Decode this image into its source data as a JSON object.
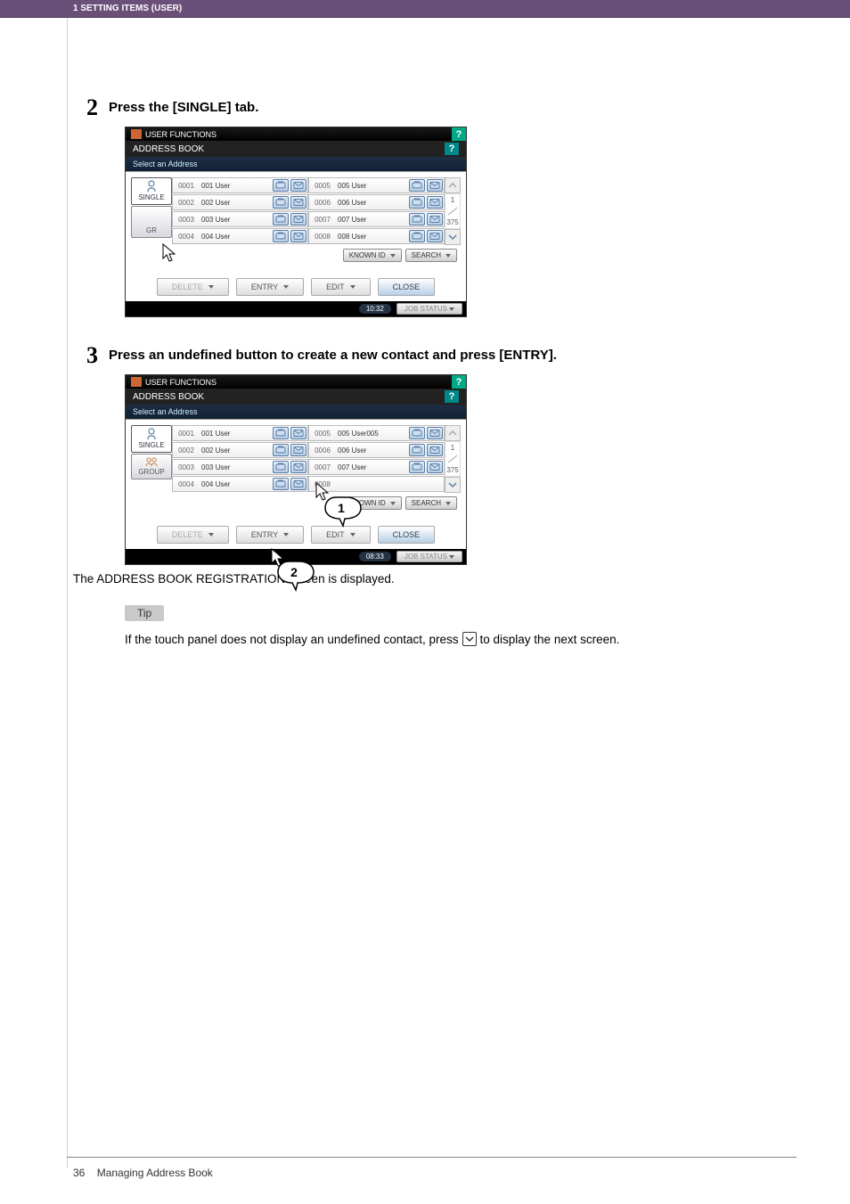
{
  "header_strip": "1 SETTING ITEMS (USER)",
  "step2": {
    "num": "2",
    "text": "Press the [SINGLE] tab."
  },
  "step3": {
    "num": "3",
    "text": "Press an undefined button to create a new contact and press [ENTRY]."
  },
  "shot_a": {
    "system_title": "USER FUNCTIONS",
    "subtitle": "ADDRESS BOOK",
    "prompt": "Select an Address",
    "tab_single": "SINGLE",
    "tab_group": "GR",
    "rows_left": [
      {
        "n": "0001",
        "name": "001 User"
      },
      {
        "n": "0002",
        "name": "002 User"
      },
      {
        "n": "0003",
        "name": "003 User"
      },
      {
        "n": "0004",
        "name": "004 User"
      }
    ],
    "rows_right": [
      {
        "n": "0005",
        "name": "005 User"
      },
      {
        "n": "0006",
        "name": "006 User"
      },
      {
        "n": "0007",
        "name": "007 User"
      },
      {
        "n": "0008",
        "name": "008 User"
      }
    ],
    "scroll_top": "1",
    "scroll_bot": "375",
    "btn_knownid": "KNOWN ID",
    "btn_search": "SEARCH",
    "foot_delete": "DELETE",
    "foot_entry": "ENTRY",
    "foot_edit": "EDIT",
    "foot_close": "CLOSE",
    "time": "10:32",
    "jobstatus": "JOB STATUS"
  },
  "shot_b": {
    "system_title": "USER FUNCTIONS",
    "subtitle": "ADDRESS BOOK",
    "prompt": "Select an Address",
    "tab_single": "SINGLE",
    "tab_group": "GROUP",
    "rows_left": [
      {
        "n": "0001",
        "name": "001 User"
      },
      {
        "n": "0002",
        "name": "002 User"
      },
      {
        "n": "0003",
        "name": "003 User"
      },
      {
        "n": "0004",
        "name": "004 User"
      }
    ],
    "rows_right": [
      {
        "n": "0005",
        "name": "005 User005"
      },
      {
        "n": "0006",
        "name": "006 User"
      },
      {
        "n": "0007",
        "name": "007 User"
      },
      {
        "n": "0008",
        "name": ""
      }
    ],
    "scroll_top": "1",
    "scroll_bot": "375",
    "btn_knownid": "NOWN ID",
    "btn_search": "SEARCH",
    "foot_delete": "DELETE",
    "foot_entry": "ENTRY",
    "foot_edit": "EDIT",
    "foot_close": "CLOSE",
    "time": "08:33",
    "jobstatus": "JOB STATUS",
    "callout1": "1",
    "callout2": "2"
  },
  "caption_after_b": "The ADDRESS BOOK REGISTRATION screen is displayed.",
  "tip_label": "Tip",
  "tip_text_a": "If the touch panel does not display an undefined contact, press",
  "tip_text_b": "to display the next screen.",
  "footer_num": "36",
  "footer_text": "Managing Address Book"
}
